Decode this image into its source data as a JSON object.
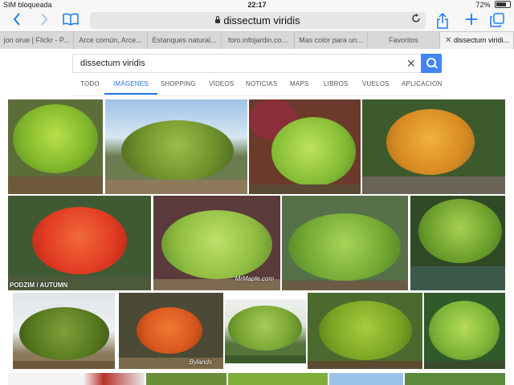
{
  "status": {
    "carrier": "SIM bloqueada",
    "time": "22:17",
    "battery": "72%",
    "battery_level": 0.72
  },
  "toolbar": {
    "back_icon": "chevron-left-icon",
    "forward_icon": "chevron-right-icon",
    "bookmarks_icon": "book-icon",
    "address": "dissectum viridis",
    "share_icon": "share-icon",
    "new_tab_icon": "plus-icon",
    "tabs_icon": "tabs-icon"
  },
  "tabs": [
    {
      "label": "jon orue | Flickr - P..."
    },
    {
      "label": "Arce común, Arce..."
    },
    {
      "label": "Estanques natural..."
    },
    {
      "label": "foro.infojardin.co..."
    },
    {
      "label": "Mas color para un..."
    },
    {
      "label": "Favoritos"
    },
    {
      "label": "dissectum viridi..."
    }
  ],
  "search": {
    "query": "dissectum viridis",
    "nav": [
      {
        "label": "TODO"
      },
      {
        "label": "IMÁGENES"
      },
      {
        "label": "SHOPPING"
      },
      {
        "label": "VÍDEOS"
      },
      {
        "label": "NOTICIAS"
      },
      {
        "label": "MAPS"
      },
      {
        "label": "LIBROS"
      },
      {
        "label": "VUELOS"
      },
      {
        "label": "APLICACIONES"
      }
    ]
  },
  "images": {
    "caption_autumn": "PODZIM / AUTUMN",
    "watermark_mrmaple": "MrMaple.com",
    "watermark_bylands": "Bylands"
  },
  "colors": {
    "accent": "#1a7cf5",
    "google_blue": "#4285f4"
  }
}
